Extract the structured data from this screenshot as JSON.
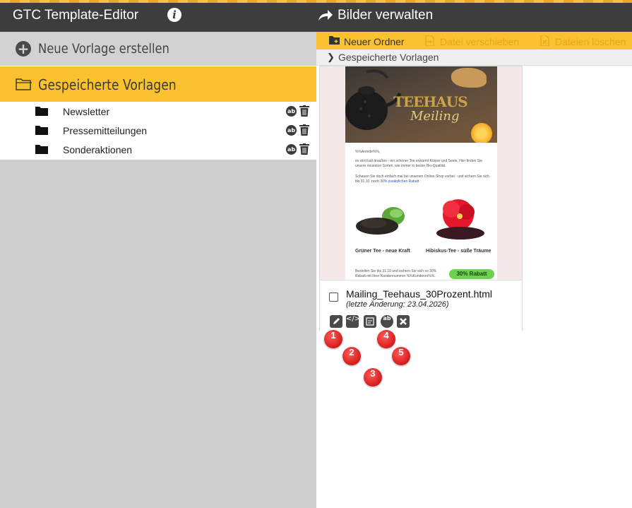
{
  "app": {
    "title": "GTC Template-Editor",
    "info_icon": "info-icon"
  },
  "left": {
    "new_template_label": "Neue Vorlage erstellen",
    "saved_label": "Gespeicherte Vorlagen",
    "folders": [
      {
        "name": "Newsletter",
        "ab_label": "ab"
      },
      {
        "name": "Pressemitteilungen",
        "ab_label": "ab"
      },
      {
        "name": "Sonderaktionen",
        "ab_label": "ab"
      }
    ]
  },
  "right": {
    "title": "Bilder verwalten",
    "toolbar": {
      "new_folder": "Neuer Ordner",
      "move_file": "Datei verschieben",
      "delete_files": "Dateien löschen"
    },
    "breadcrumb": "Gespeicherte Vorlagen",
    "file": {
      "name": "Mailing_Teehaus_30Prozent.html",
      "modified": "(letzte Änderung: 23.04.2026)",
      "checked": false,
      "actions": [
        "edit-icon",
        "code-icon",
        "preview-icon",
        "rename-icon",
        "delete-icon"
      ],
      "rename_label": "ab"
    },
    "preview": {
      "hero_title_1": "TEEHAUS",
      "hero_title_2": "Meiling",
      "greeting": "%%Anrede%%,",
      "para1": "es wird kalt draußen - ein schöner Tee erwärmt Körper und Seele. Hier finden Sie unsere neuesten Sorten, wie immer in bester Bio-Qualität.",
      "para2_a": "Schauen Sie doch einfach mal bei unserem Online-Shop vorbei - und sichern Sie sich bis 31.10. noch",
      "para2_link": "30% zusätzlichen Rabatt",
      "product1": "Grüner Tee - neue Kraft",
      "product2": "Hibiskus-Tee - süße Träume",
      "footer_text": "Bestellen Sie bis 31.10 und sichern Sie sich so 30% Rabatt mit Ihrer Kundennummer %%Kundennr%%.",
      "badge": "30% Rabatt"
    },
    "markers": [
      "1",
      "2",
      "3",
      "4",
      "5"
    ]
  },
  "colors": {
    "header_bg": "#3d3d3d",
    "accent_yellow": "#fcc12f",
    "panel_gray": "#cfcfcf",
    "marker_red": "#d61c1c",
    "badge_green": "#6cd34e"
  }
}
